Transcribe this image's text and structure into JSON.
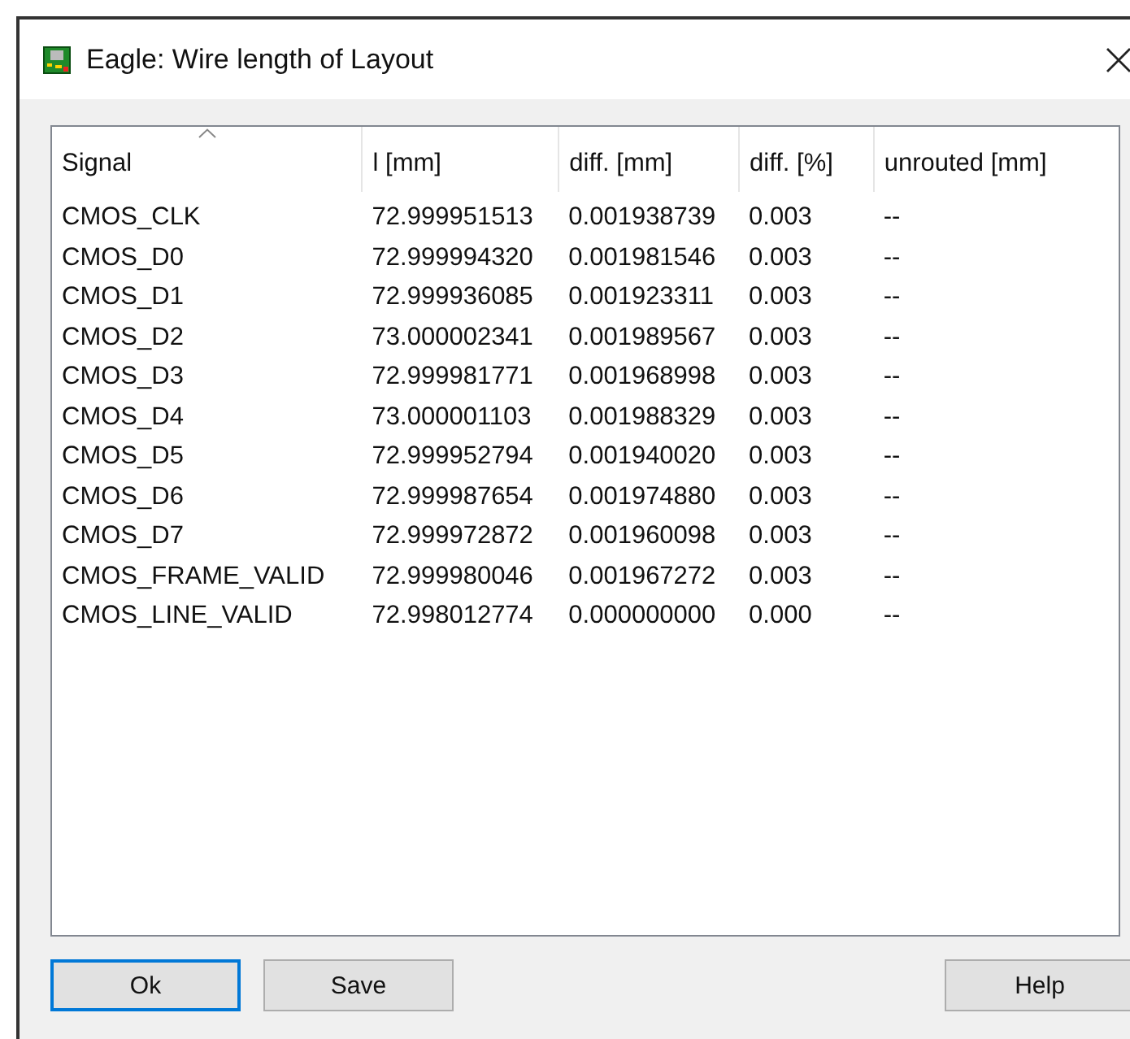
{
  "window": {
    "title": "Eagle: Wire length of Layout"
  },
  "table": {
    "columns": [
      {
        "label": "Signal",
        "sorted": true
      },
      {
        "label": "l [mm]",
        "sorted": false
      },
      {
        "label": "diff. [mm]",
        "sorted": false
      },
      {
        "label": "diff. [%]",
        "sorted": false
      },
      {
        "label": "unrouted [mm]",
        "sorted": false
      }
    ],
    "rows": [
      [
        "CMOS_CLK",
        "72.999951513",
        "0.001938739",
        "0.003",
        "--"
      ],
      [
        "CMOS_D0",
        "72.999994320",
        "0.001981546",
        "0.003",
        "--"
      ],
      [
        "CMOS_D1",
        "72.999936085",
        "0.001923311",
        "0.003",
        "--"
      ],
      [
        "CMOS_D2",
        "73.000002341",
        "0.001989567",
        "0.003",
        "--"
      ],
      [
        "CMOS_D3",
        "72.999981771",
        "0.001968998",
        "0.003",
        "--"
      ],
      [
        "CMOS_D4",
        "73.000001103",
        "0.001988329",
        "0.003",
        "--"
      ],
      [
        "CMOS_D5",
        "72.999952794",
        "0.001940020",
        "0.003",
        "--"
      ],
      [
        "CMOS_D6",
        "72.999987654",
        "0.001974880",
        "0.003",
        "--"
      ],
      [
        "CMOS_D7",
        "72.999972872",
        "0.001960098",
        "0.003",
        "--"
      ],
      [
        "CMOS_FRAME_VALID",
        "72.999980046",
        "0.001967272",
        "0.003",
        "--"
      ],
      [
        "CMOS_LINE_VALID",
        "72.998012774",
        "0.000000000",
        "0.000",
        "--"
      ]
    ]
  },
  "buttons": [
    {
      "label": "Ok",
      "default": true
    },
    {
      "label": "Save",
      "default": false
    },
    {
      "label": "Help",
      "default": false
    }
  ]
}
